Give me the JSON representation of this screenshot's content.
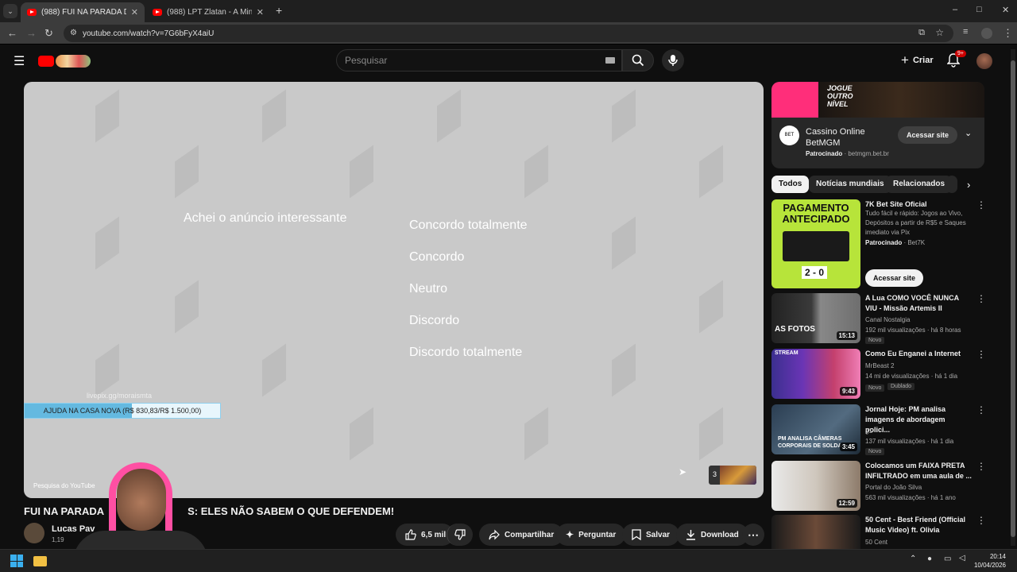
{
  "browser": {
    "tabs": [
      {
        "label": "(988) FUI NA PARADA DOS BO...",
        "active": true
      },
      {
        "label": "(988) LPT Zlatan - A Minha Fave...",
        "active": false
      }
    ],
    "new_tab": "+",
    "url": "youtube.com/watch?v=7G6bFyX4aiU",
    "window_controls": [
      "–",
      "□",
      "✕"
    ]
  },
  "header": {
    "search_placeholder": "Pesquisar",
    "create_label": "Criar",
    "notif_count": "9+"
  },
  "player": {
    "survey_question": "Achei o anúncio interessante",
    "options": [
      "Concordo totalmente",
      "Concordo",
      "Neutro",
      "Discordo",
      "Discordo totalmente"
    ],
    "livepix_url": "livepix.gg/moraismta",
    "goal_text": "AJUDA NA CASA NOVA (R$ 830,83/R$ 1.500,00)",
    "goal_progress": 0.55,
    "yt_research_label": "Pesquisa do YouTube",
    "thumb_count": "3"
  },
  "video": {
    "title": "FUI NA PARADA DOS BOLSONARISTAS: ELES NÃO SABEM O QUE DEFENDEM!",
    "title_visible": "FUI NA PARADA",
    "title_rest": "S: ELES NÃO SABEM O QUE DEFENDEM!",
    "channel": "Lucas Pav",
    "subs": "1,19"
  },
  "actions": {
    "likes": "6,5 mil",
    "share": "Compartilhar",
    "ask": "Perguntar",
    "save": "Salvar",
    "download": "Download"
  },
  "ad": {
    "banner_text_1": "JOGUE",
    "banner_text_2": "OUTRO",
    "banner_text_3": "NÍVEL",
    "name_line1": "Cassino Online",
    "name_line2": "BetMGM",
    "sponsored": "Patrocinado",
    "domain": "betmgm.bet.br",
    "cta": "Acessar site"
  },
  "chips": [
    "Todos",
    "Notícias mundiais",
    "Relacionados"
  ],
  "sponsored_video": {
    "thumb_text": "PAGAMENTO ANTECIPADO",
    "score": "2 - 0",
    "title": "7K Bet Site Oficial",
    "desc": "Tudo fácil e rápido: Jogos ao Vivo, Depósitos a partir de R$5 e Saques imediato via Pix",
    "sponsored": "Patrocinado",
    "advertiser": "Bet7K",
    "cta": "Acessar site"
  },
  "recommended": [
    {
      "title": "A Lua COMO VOCÊ NUNCA VIU - Missão Artemis II",
      "channel": "Canal Nostalgia",
      "views": "192 mil visualizações",
      "age": "há 8 horas",
      "duration": "15:13",
      "badge": "Novo",
      "thumb_caption": "AS FOTOS"
    },
    {
      "title": "Como Eu Enganei a Internet",
      "channel": "MrBeast 2",
      "views": "14 mi de visualizações",
      "age": "há 1 dia",
      "duration": "9:43",
      "badge": "Novo",
      "badge2": "Dublado",
      "thumb_caption": "STREAM"
    },
    {
      "title": "Jornal Hoje: PM analisa imagens de abordagem polici...",
      "channel": "g1",
      "views": "137 mil visualizações",
      "age": "há 1 dia",
      "duration": "3:45",
      "badge": "Novo",
      "thumb_caption": "PM ANALISA CÂMERAS CORPORAIS DE SOLDA"
    },
    {
      "title": "Colocamos um FAIXA PRETA INFILTRADO em uma aula de ...",
      "channel": "Portal do João Silva",
      "views": "563 mil visualizações",
      "age": "há 1 ano",
      "duration": "12:59"
    },
    {
      "title": "50 Cent - Best Friend (Official Music Video) ft. Olivia",
      "channel": "50 Cent",
      "views": "",
      "age": "",
      "duration": ""
    }
  ],
  "taskbar": {
    "time": "20:14",
    "date": "10/04/2026"
  }
}
